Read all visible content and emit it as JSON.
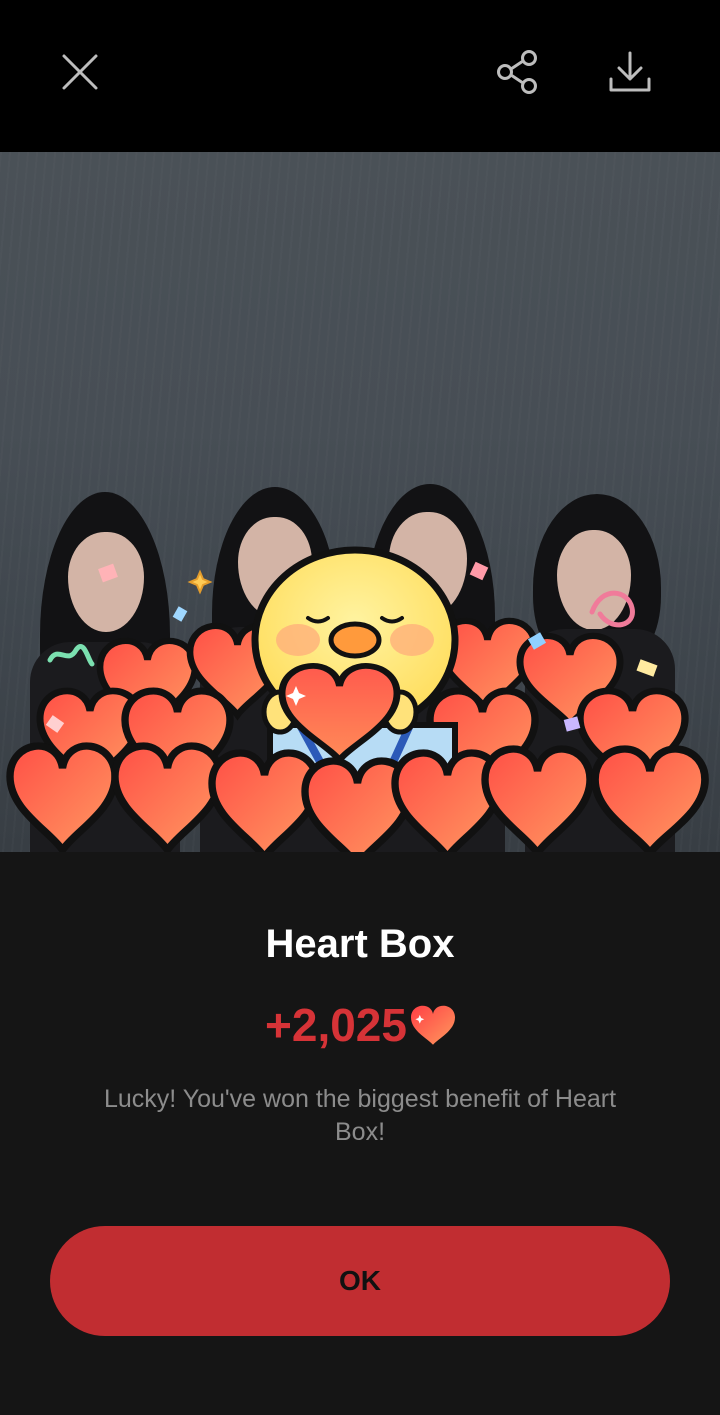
{
  "toolbar": {
    "close_icon": "close-icon",
    "share_icon": "share-icon",
    "download_icon": "download-icon"
  },
  "reward": {
    "title": "Heart Box",
    "amount": "+2,025",
    "amount_icon": "heart-icon",
    "message": "Lucky! You've won the biggest benefit of Heart Box!",
    "ok_label": "OK"
  },
  "colors": {
    "accent_red": "#c12d31",
    "amount_red": "#d63337",
    "panel_bg": "#151515",
    "message_gray": "#8c8c8c"
  }
}
